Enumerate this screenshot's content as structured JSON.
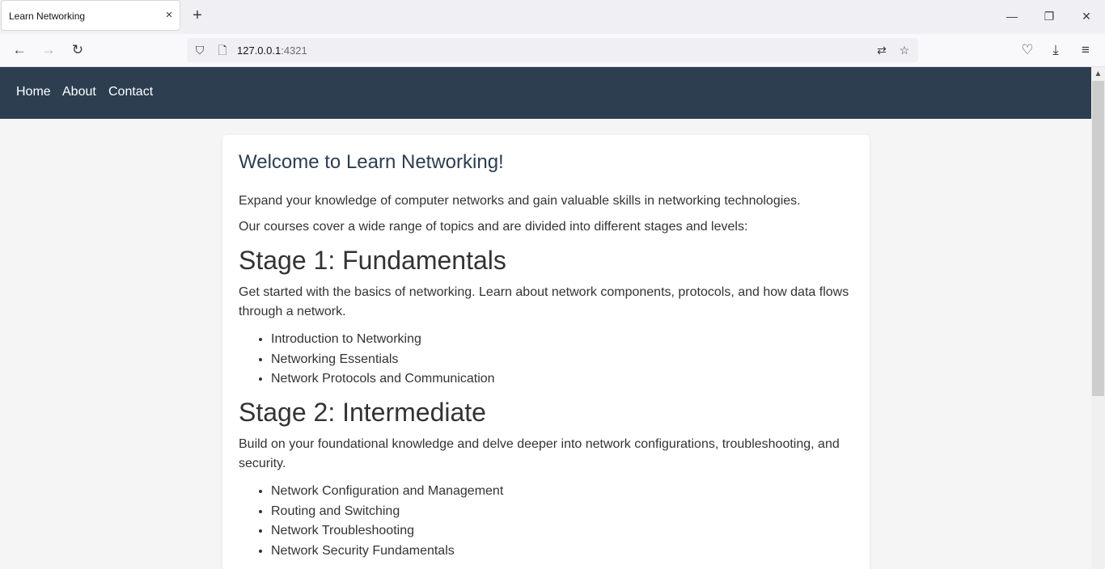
{
  "browser": {
    "tab_title": "Learn Networking",
    "tab_close_icon": "×",
    "new_tab_icon": "+",
    "url_host": "127.0.0.1",
    "url_port": ":4321",
    "window_controls": {
      "minimize": "—",
      "restore": "❐",
      "close": "✕"
    },
    "nav": {
      "back": "←",
      "forward": "→",
      "reload": "↻"
    },
    "icons": {
      "shield": "⛉",
      "page": "🗋",
      "translate": "⇄",
      "star": "☆",
      "pocket": "♡",
      "download": "⤓",
      "menu": "≡"
    }
  },
  "site_nav": {
    "home": "Home",
    "about": "About",
    "contact": "Contact"
  },
  "content": {
    "heading": "Welcome to Learn Networking!",
    "intro1": "Expand your knowledge of computer networks and gain valuable skills in networking technologies.",
    "intro2": "Our courses cover a wide range of topics and are divided into different stages and levels:",
    "stages": [
      {
        "title": "Stage 1: Fundamentals",
        "description": "Get started with the basics of networking. Learn about network components, protocols, and how data flows through a network.",
        "courses": [
          "Introduction to Networking",
          "Networking Essentials",
          "Network Protocols and Communication"
        ]
      },
      {
        "title": "Stage 2: Intermediate",
        "description": "Build on your foundational knowledge and delve deeper into network configurations, troubleshooting, and security.",
        "courses": [
          "Network Configuration and Management",
          "Routing and Switching",
          "Network Troubleshooting",
          "Network Security Fundamentals"
        ]
      }
    ]
  },
  "colors": {
    "nav_bg": "#2c3e50",
    "heading": "#2c3e50",
    "text": "#333333",
    "page_bg": "#f5f5f5"
  }
}
